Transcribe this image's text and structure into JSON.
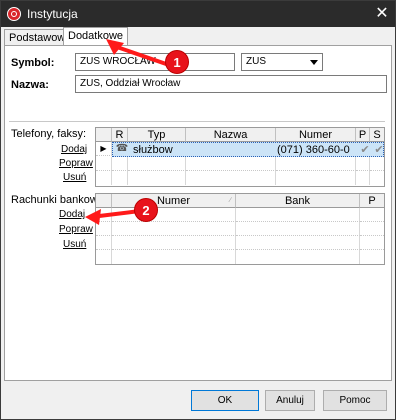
{
  "window": {
    "title": "Instytucja"
  },
  "tabs": [
    {
      "label": "Podstawowe"
    },
    {
      "label": "Dodatkowe"
    }
  ],
  "form": {
    "symbol_label": "Symbol:",
    "symbol_value": "ZUS WROCŁAW",
    "symbol_select_value": "ZUS",
    "nazwa_label": "Nazwa:",
    "nazwa_value": "ZUS, Oddział Wrocław"
  },
  "phones": {
    "section_label": "Telefony, faksy:",
    "actions": {
      "add": "Dodaj",
      "edit": "Popraw",
      "delete": "Usuń"
    },
    "columns": [
      "R",
      "Typ",
      "Nazwa",
      "Numer",
      "P",
      "S"
    ],
    "rows": [
      {
        "typ": "służbow",
        "nazwa": "",
        "numer": "(071) 360-60-0"
      }
    ]
  },
  "accounts": {
    "section_label": "Rachunki bankowe:",
    "actions": {
      "add": "Dodaj",
      "edit": "Popraw",
      "delete": "Usuń"
    },
    "columns": [
      "Numer",
      "Bank",
      "P"
    ]
  },
  "buttons": {
    "ok": "OK",
    "cancel": "Anuluj",
    "help": "Pomoc"
  },
  "annotations": {
    "badge1": "1",
    "badge2": "2"
  },
  "colors": {
    "annotation": "#e8131b",
    "selection": "#cce4f7",
    "titlebar": "#2b2b2b"
  }
}
